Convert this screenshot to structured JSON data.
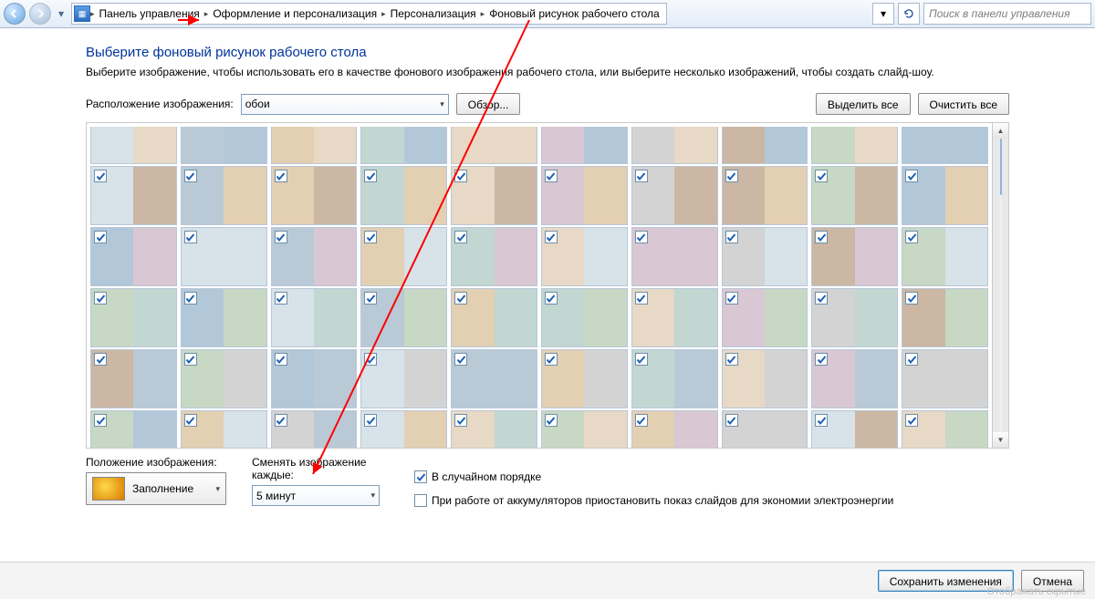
{
  "header": {
    "breadcrumbs": [
      "Панель управления",
      "Оформление и персонализация",
      "Персонализация",
      "Фоновый рисунок рабочего стола"
    ],
    "search_placeholder": "Поиск в панели управления"
  },
  "page": {
    "title": "Выберите фоновый рисунок рабочего стола",
    "description": "Выберите изображение, чтобы использовать его в качестве фонового изображения рабочего стола, или выберите несколько изображений, чтобы создать слайд-шоу."
  },
  "location": {
    "label": "Расположение изображения:",
    "value": "обои",
    "browse": "Обзор..."
  },
  "actions": {
    "select_all": "Выделить все",
    "clear_all": "Очистить все"
  },
  "gallery": {
    "columns": 10,
    "visible_rows": 5,
    "all_checked": true
  },
  "options": {
    "position_label": "Положение изображения:",
    "position_value": "Заполнение",
    "interval_label": "Сменять изображение каждые:",
    "interval_value": "5 минут",
    "shuffle": {
      "label": "В случайном порядке",
      "checked": true
    },
    "battery": {
      "label": "При работе от аккумуляторов приостановить показ слайдов для экономии электроэнергии",
      "checked": false
    }
  },
  "footer": {
    "save": "Сохранить изменения",
    "cancel": "Отмена"
  },
  "ghost": "Отображать скрытые"
}
